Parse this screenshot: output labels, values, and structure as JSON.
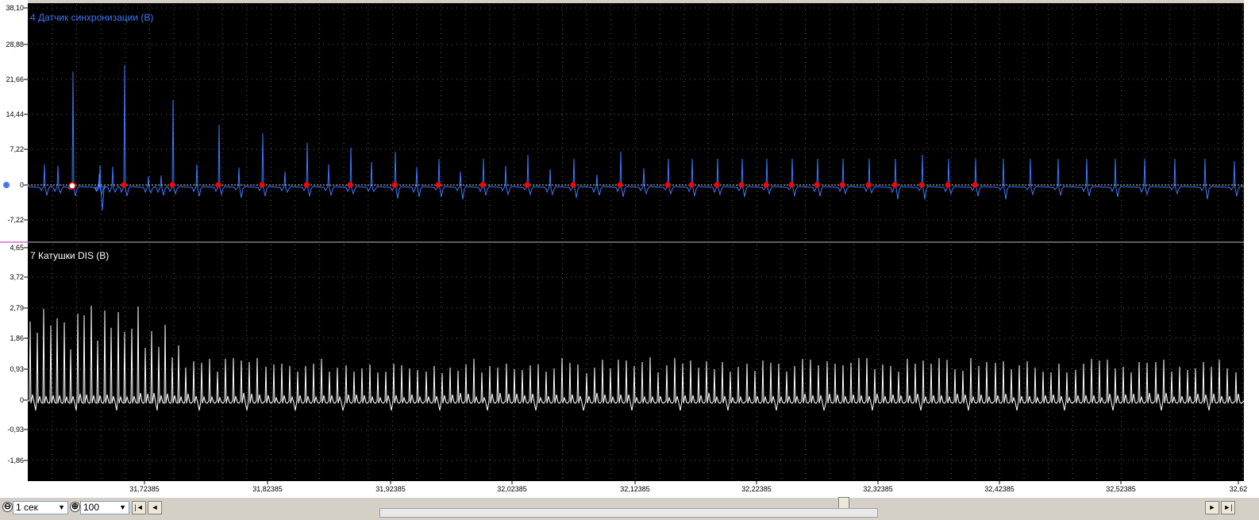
{
  "channels": [
    {
      "title": "4 Датчик синхронизации (В)",
      "color": "#3c78ff",
      "y_ticks": [
        "38,10",
        "28,88",
        "21,66",
        "14,44",
        "7,22",
        "0",
        "-7,22"
      ],
      "y_range": [
        -14.44,
        38.1
      ]
    },
    {
      "title": "7 Катушки DIS (В)",
      "color": "#ffffff",
      "y_ticks": [
        "4,65",
        "3,72",
        "2,79",
        "1,86",
        "0,93",
        "0",
        "-0,93",
        "-1,86"
      ],
      "y_range": [
        -2.79,
        4.65
      ]
    }
  ],
  "time_axis": {
    "labels": [
      "31,72385",
      "31,82385",
      "31,92385",
      "32,02385",
      "32,12385",
      "32,22385",
      "32,32385",
      "32,42385",
      "32,52385",
      "32,62"
    ]
  },
  "toolbar": {
    "zoom_out_symbol": "⊖",
    "zoom_in_symbol": "⊕",
    "time_scale": "1 сек",
    "amplitude_scale": "100",
    "nav_first": "|◄",
    "nav_prev": "◄",
    "nav_next": "►",
    "nav_last": "►|"
  },
  "colors": {
    "background": "#000000",
    "grid_dot": "#606060",
    "marker": "#ff0000",
    "axis_bg": "#ffffff"
  }
}
